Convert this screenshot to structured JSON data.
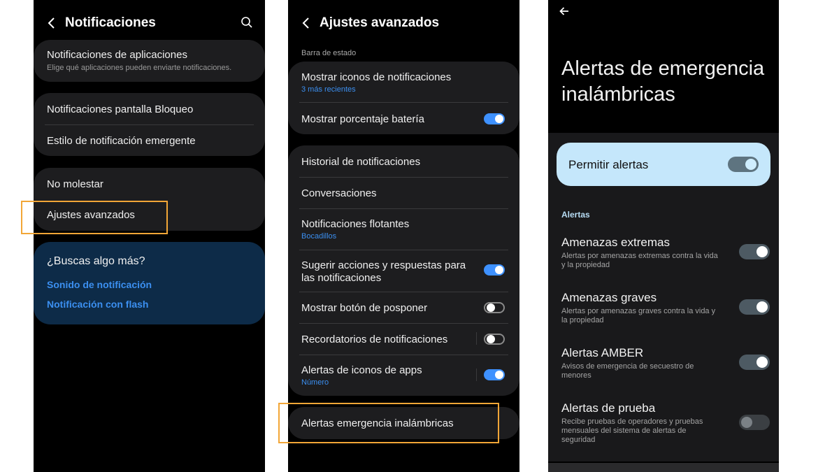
{
  "panel1": {
    "header": {
      "title": "Notificaciones",
      "back_icon": "chevron-left-icon",
      "search_icon": "search-icon"
    },
    "app_notifications": {
      "title": "Notificaciones de aplicaciones",
      "subtitle": "Elige qué aplicaciones pueden enviarte notificaciones."
    },
    "group2": [
      "Notificaciones pantalla Bloqueo",
      "Estilo de notificación emergente"
    ],
    "group3": [
      "No molestar",
      "Ajustes avanzados"
    ],
    "suggest": {
      "title": "¿Buscas algo más?",
      "links": [
        "Sonido de notificación",
        "Notificación con flash"
      ]
    }
  },
  "panel2": {
    "header": {
      "title": "Ajustes avanzados",
      "back_icon": "chevron-left-icon"
    },
    "section_label": "Barra de estado",
    "status_items": [
      {
        "title": "Mostrar iconos de notificaciones",
        "subtitle": "3 más recientes"
      },
      {
        "title": "Mostrar porcentaje batería",
        "toggle": true
      }
    ],
    "items": [
      {
        "title": "Historial de notificaciones"
      },
      {
        "title": "Conversaciones"
      },
      {
        "title": "Notificaciones flotantes",
        "subtitle": "Bocadillos"
      },
      {
        "title_line1": "Sugerir acciones y respuestas para",
        "title_line2": "las notificaciones",
        "toggle": true
      },
      {
        "title": "Mostrar botón de posponer",
        "toggle": false
      },
      {
        "title": "Recordatorios de notificaciones",
        "toggle": false
      },
      {
        "title": "Alertas de iconos de apps",
        "subtitle": "Número",
        "toggle": true
      }
    ],
    "emergency": {
      "title": "Alertas emergencia inalámbricas"
    }
  },
  "panel3": {
    "back_icon": "arrow-left-icon",
    "title_line1": "Alertas de emergencia",
    "title_line2": "inalámbricas",
    "allow": {
      "label": "Permitir alertas",
      "on": true
    },
    "section_label": "Alertas",
    "items": [
      {
        "title": "Amenazas extremas",
        "sub_line1": "Alertas por amenazas extremas contra la vida",
        "sub_line2": "y la propiedad",
        "on": true
      },
      {
        "title": "Amenazas graves",
        "sub_line1": "Alertas por amenazas graves contra la vida y",
        "sub_line2": "la propiedad",
        "on": true
      },
      {
        "title": "Alertas AMBER",
        "sub_line1": "Avisos de emergencia de secuestro de",
        "sub_line2": "menores",
        "on": true
      },
      {
        "title": "Alertas de prueba",
        "sub_line1": "Recibe pruebas de operadores y pruebas",
        "sub_line2": "mensuales del sistema de alertas de",
        "sub_line3": "seguridad",
        "on": false
      }
    ]
  },
  "colors": {
    "highlight": "#f2a637",
    "toggle_on": "#3e91ff",
    "link_blue": "#3b8ff0",
    "allow_bg": "#c5e7fb"
  }
}
